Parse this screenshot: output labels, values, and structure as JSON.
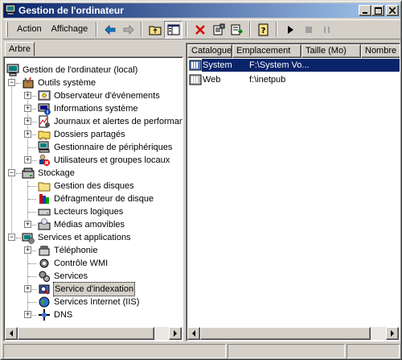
{
  "window": {
    "title": "Gestion de l'ordinateur",
    "icon": "computer-management-icon"
  },
  "title_buttons": [
    "minimize-icon",
    "maximize-icon",
    "close-icon"
  ],
  "menu": {
    "action": "Action",
    "view": "Affichage"
  },
  "toolbar_icons": [
    "back-arrow-icon",
    "forward-arrow-icon",
    "up-folder-icon",
    "show-hide-tree-icon",
    "delete-icon",
    "properties-icon",
    "export-list-icon",
    "help-icon",
    "start-service-icon",
    "stop-service-icon",
    "pause-service-icon"
  ],
  "tabs": {
    "tree": "Arbre"
  },
  "tree": {
    "root": "Gestion de l'ordinateur (local)",
    "system_tools": "Outils système",
    "event_viewer": "Observateur d'événements",
    "system_info": "Informations système",
    "perf_logs": "Journaux et alertes de performance",
    "shared_folders": "Dossiers partagés",
    "device_manager": "Gestionnaire de périphériques",
    "local_users": "Utilisateurs et groupes locaux",
    "storage": "Stockage",
    "disk_management": "Gestion des disques",
    "defrag": "Défragmenteur de disque",
    "logical_drives": "Lecteurs logiques",
    "removable_media": "Médias amovibles",
    "services_apps": "Services et applications",
    "telephony": "Téléphonie",
    "wmi": "Contrôle WMI",
    "services": "Services",
    "indexing": "Service d'indexation",
    "iis": "Services Internet (IIS)",
    "dns": "DNS"
  },
  "list": {
    "columns": [
      "Catalogue",
      "Emplacement",
      "Taille (Mo)",
      "Nombre"
    ],
    "rows": [
      {
        "catalog": "System",
        "location": "F:\\System Vo...",
        "selected": true
      },
      {
        "catalog": "Web",
        "location": "f:\\inetpub",
        "selected": false
      }
    ]
  }
}
